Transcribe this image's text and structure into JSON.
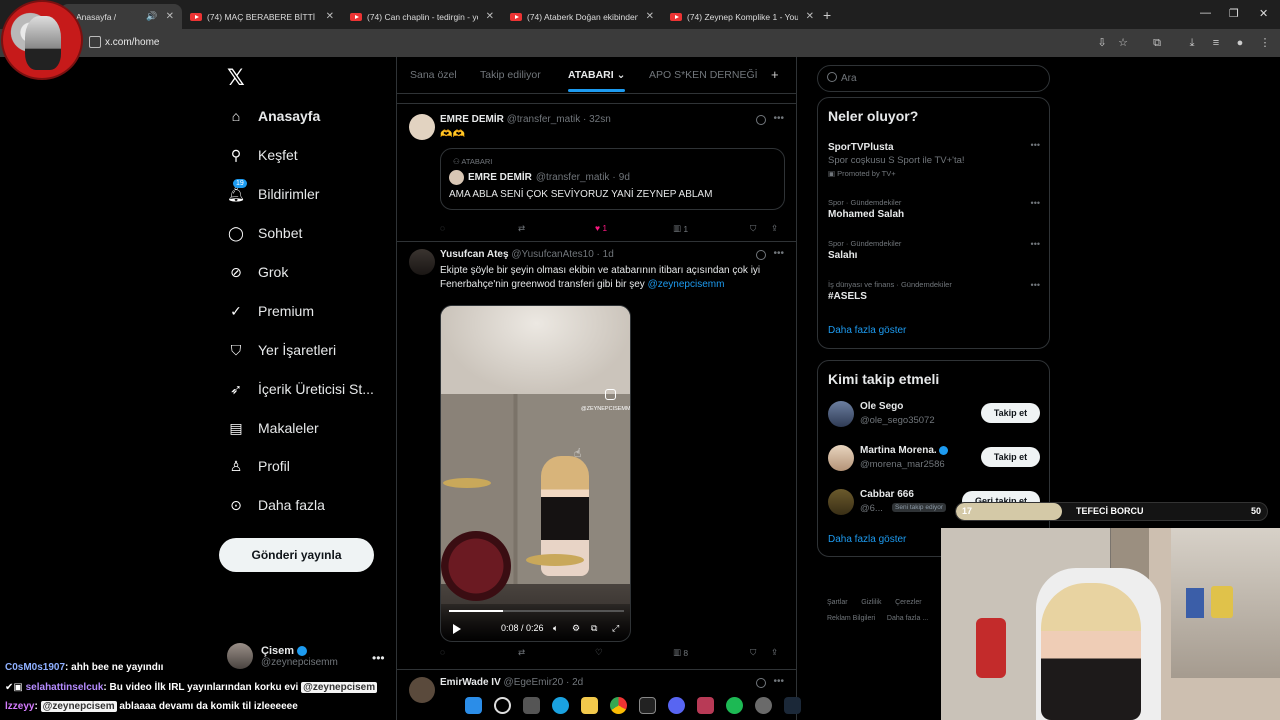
{
  "browser": {
    "tabs": [
      {
        "title": "Anasayfa / X",
        "active": true
      },
      {
        "title": "(74) MAÇ BERABERE BİTTİ UMU",
        "active": false
      },
      {
        "title": "(74) Can chaplin - tedirgin - yo",
        "active": false
      },
      {
        "title": "(74) Ataberk Doğan ekibinden",
        "active": false
      },
      {
        "title": "(74) Zeynep Komplike 1 - YouTu",
        "active": false
      }
    ],
    "url": "x.com/home"
  },
  "nav": {
    "items": [
      {
        "label": "Anasayfa",
        "icon": "home-icon",
        "bold": true
      },
      {
        "label": "Keşfet",
        "icon": "search-icon"
      },
      {
        "label": "Bildirimler",
        "icon": "bell-icon",
        "badge": "19"
      },
      {
        "label": "Sohbet",
        "icon": "chat-icon"
      },
      {
        "label": "Grok",
        "icon": "grok-icon"
      },
      {
        "label": "Premium",
        "icon": "premium-icon"
      },
      {
        "label": "Yer İşaretleri",
        "icon": "bookmark-icon"
      },
      {
        "label": "İçerik Üreticisi St...",
        "icon": "rocket-icon"
      },
      {
        "label": "Makaleler",
        "icon": "article-icon"
      },
      {
        "label": "Profil",
        "icon": "person-icon"
      },
      {
        "label": "Daha fazla",
        "icon": "more-icon"
      }
    ],
    "post_button": "Gönderi yayınla",
    "account": {
      "name": "Çisem",
      "handle": "@zeynepcisemm"
    }
  },
  "feed": {
    "tabs": [
      "Sana özel",
      "Takip ediliyor",
      "ATABARI",
      "APO S*KEN DERNEĞİ"
    ],
    "active_tab": "ATABARI",
    "posts": [
      {
        "name": "EMRE DEMİR",
        "handle": "@transfer_matik",
        "time": "32sn",
        "text": "🫶🫶",
        "quote": {
          "label": "ATABARI",
          "name": "EMRE DEMİR",
          "handle": "@transfer_matik",
          "time": "9d",
          "text": "AMA ABLA SENİ ÇOK SEVİYORUZ YANİ ZEYNEP ABLAM"
        },
        "likes": "1",
        "views": "1"
      },
      {
        "name": "Yusufcan Ateş",
        "handle": "@YusufcanAtes10",
        "time": "1d",
        "text": "Ekipte şöyle bir şeyin olması ekibin ve atabarının itibarı açısından çok iyi Fenerbahçe'nin greenwod transferi gibi bir şey",
        "mention": "@zeynepcisemm",
        "video": {
          "time": "0:08 / 0:26",
          "progress": 0.31,
          "watermark": "@ZEYNEPCISEMM"
        },
        "views": "8"
      },
      {
        "name": "EmirWade IV",
        "handle": "@EgeEmir20",
        "time": "2d"
      }
    ]
  },
  "sidebar": {
    "search_placeholder": "Ara",
    "trends_title": "Neler oluyor?",
    "trends": [
      {
        "name": "SporTVPlusta",
        "desc": "Spor coşkusu S Sport ile TV+'ta!",
        "meta": "Promoted by TV+",
        "promoted": true
      },
      {
        "meta": "Spor · Gündemdekiler",
        "name": "Mohamed Salah"
      },
      {
        "meta": "Spor · Gündemdekiler",
        "name": "Salahı"
      },
      {
        "meta": "İş dünyası ve finans · Gündemdekiler",
        "name": "#ASELS"
      }
    ],
    "trends_more": "Daha fazla göster",
    "who_title": "Kimi takip etmeli",
    "who": [
      {
        "name": "Ole Sego",
        "handle": "@ole_sego35072",
        "button": "Takip et"
      },
      {
        "name": "Martina Morena.",
        "handle": "@morena_mar2586",
        "button": "Takip et",
        "verified": true
      },
      {
        "name": "Cabbar 666",
        "handle": "@6...",
        "button": "Geri takip et",
        "tag": "Seni takip ediyor"
      }
    ],
    "who_more": "Daha fazla göster",
    "footer": [
      "Şartlar",
      "Gizlilik",
      "Çerezler",
      "Reklam Bilgileri",
      "Daha fazla ..."
    ]
  },
  "overlay": {
    "goal": {
      "current": "17",
      "label": "TEFECİ BORCU",
      "target": "50",
      "fraction": 0.34
    },
    "chat": [
      {
        "user": "C0sM0s1907",
        "msg": ": ahh bee ne yayındıı"
      },
      {
        "user": "selahattinselcuk",
        "msg": ": Bu video İlk IRL yayınlarından korku evi",
        "mention": "@zeynepcisem"
      },
      {
        "user": "lzzeyy",
        "mention": "@zeynepcisem",
        "msg": " ablaaaa devamı da komik til izleeeeee"
      }
    ]
  }
}
